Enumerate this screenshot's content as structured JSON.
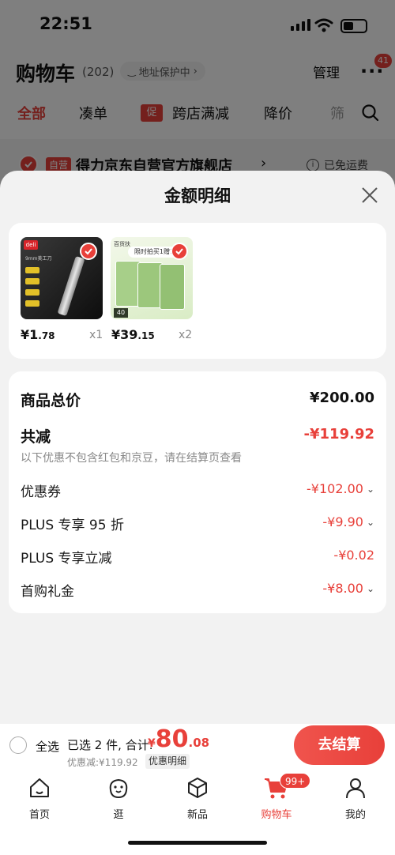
{
  "status_bar": {
    "time": "22:51"
  },
  "header": {
    "title": "购物车",
    "count": "(202)",
    "address": "地址保护中",
    "manage": "管理",
    "msg_badge": "41"
  },
  "filters": {
    "all": "全部",
    "bundle": "凑单",
    "promo_tag": "促",
    "cross_store": "跨店满减",
    "price_drop": "降价",
    "more": "筛"
  },
  "store": {
    "tag": "自营",
    "name": "得力京东自营官方旗舰店",
    "free_ship": "已免运费"
  },
  "sheet": {
    "title": "金额明细",
    "products": [
      {
        "price_int": "¥1",
        "price_dec": ".78",
        "qty": "x1",
        "img_brand": "deli",
        "img_text": "9mm美工刀"
      },
      {
        "price_int": "¥39",
        "price_dec": ".15",
        "qty": "x2",
        "img_brand": "百货扶",
        "img_text": "限时拍买1赠1",
        "img_tag": "40"
      }
    ],
    "total_label": "商品总价",
    "total_value": "¥200.00",
    "discount_label": "共减",
    "discount_value": "-¥119.92",
    "discount_note": "以下优惠不包含红包和京豆，请在结算页查看",
    "items": [
      {
        "label": "优惠券",
        "value": "-¥102.00",
        "chevron": true
      },
      {
        "label": "PLUS 专享 95 折",
        "value": "-¥9.90",
        "chevron": true
      },
      {
        "label": "PLUS 专享立减",
        "value": "-¥0.02",
        "chevron": false
      },
      {
        "label": "首购礼金",
        "value": "-¥8.00",
        "chevron": true
      }
    ]
  },
  "bottom": {
    "select_all": "全选",
    "selected": "已选 2 件, 合计:",
    "yen": "¥",
    "total_int": "80",
    "total_dec": ".08",
    "saved": "优惠减:¥119.92",
    "detail": "优惠明细",
    "checkout": "去结算"
  },
  "tabbar": {
    "items": [
      {
        "label": "首页",
        "icon": "home-icon"
      },
      {
        "label": "逛",
        "icon": "face-icon"
      },
      {
        "label": "新品",
        "icon": "box-icon"
      },
      {
        "label": "购物车",
        "icon": "cart-icon",
        "badge": "99+",
        "active": true
      },
      {
        "label": "我的",
        "icon": "user-icon"
      }
    ]
  },
  "colors": {
    "accent": "#e8403a",
    "text": "#1a1a1a",
    "muted": "#888888"
  }
}
